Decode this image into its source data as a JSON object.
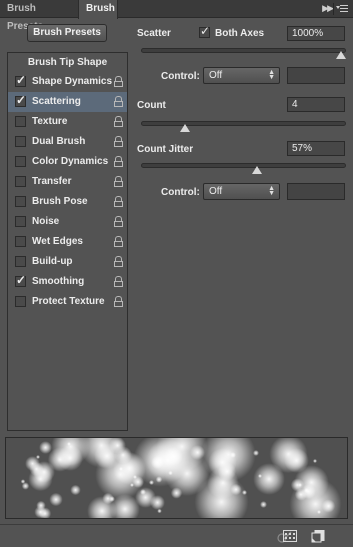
{
  "tabs": {
    "presets": "Brush Presets",
    "brush": "Brush"
  },
  "panel_menu": {
    "collapse_glyph": "▶▶",
    "menu_icon": "panel-menu-icon"
  },
  "left": {
    "presets_button": "Brush Presets",
    "tip_shape": "Brush Tip Shape",
    "options": [
      {
        "label": "Shape Dynamics",
        "checked": true,
        "selected": false
      },
      {
        "label": "Scattering",
        "checked": true,
        "selected": true
      },
      {
        "label": "Texture",
        "checked": false,
        "selected": false
      },
      {
        "label": "Dual Brush",
        "checked": false,
        "selected": false
      },
      {
        "label": "Color Dynamics",
        "checked": false,
        "selected": false
      },
      {
        "label": "Transfer",
        "checked": false,
        "selected": false
      },
      {
        "label": "Brush Pose",
        "checked": false,
        "selected": false
      },
      {
        "label": "Noise",
        "checked": false,
        "selected": false
      },
      {
        "label": "Wet Edges",
        "checked": false,
        "selected": false
      },
      {
        "label": "Build-up",
        "checked": false,
        "selected": false
      },
      {
        "label": "Smoothing",
        "checked": true,
        "selected": false
      },
      {
        "label": "Protect Texture",
        "checked": false,
        "selected": false
      }
    ]
  },
  "right": {
    "scatter": {
      "label": "Scatter",
      "both_axes_label": "Both Axes",
      "both_axes_checked": true,
      "value": "1000%",
      "slider_fraction": 1.0
    },
    "control1": {
      "label": "Control:",
      "value": "Off"
    },
    "count": {
      "label": "Count",
      "value": "4",
      "slider_fraction": 0.2
    },
    "count_jitter": {
      "label": "Count Jitter",
      "value": "57%",
      "slider_fraction": 0.57
    },
    "control2": {
      "label": "Control:",
      "value": "Off"
    }
  },
  "check_glyph": "✓",
  "colors": {
    "panel_bg": "#535353",
    "selected_row": "#5c6a7a",
    "tab_bar": "#3a3a3a"
  },
  "bottom_icons": [
    "brush-toggle-icon",
    "grid-icon",
    "create-new-preset-icon"
  ]
}
